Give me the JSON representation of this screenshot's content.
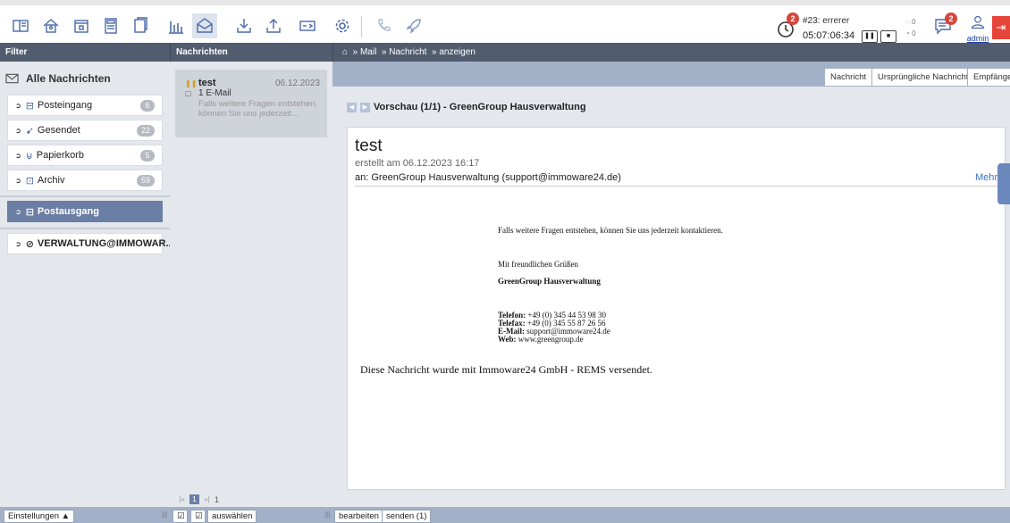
{
  "toolbar": {
    "icons": [
      "dashboard-icon",
      "home-icon",
      "calendar-icon",
      "calculator-icon",
      "documents-icon",
      "chart-icon",
      "mail-icon",
      "download-icon",
      "upload-icon",
      "card-icon",
      "settings-icon",
      "phone-icon",
      "rocket-icon"
    ],
    "active_icon": "mail-icon",
    "ticket_text": "#23: errerer",
    "ticket_time": "05:07:06:34",
    "ticket_badge": "2",
    "notes_badge": "2",
    "counter_a": "0",
    "counter_b": "0",
    "user_label": "admin"
  },
  "headers": {
    "filter": "Filter",
    "messages": "Nachrichten",
    "breadcrumb": [
      "Mail",
      "Nachricht",
      "anzeigen"
    ]
  },
  "filter": {
    "all_label": "Alle Nachrichten",
    "folders": [
      {
        "label": "Posteingang",
        "count": "6",
        "icon": "inbox-icon"
      },
      {
        "label": "Gesendet",
        "count": "22",
        "icon": "sent-icon"
      },
      {
        "label": "Papierkorb",
        "count": "5",
        "icon": "trash-icon"
      },
      {
        "label": "Archiv",
        "count": "59",
        "icon": "archive-icon"
      }
    ],
    "outbox_label": "Postausgang",
    "account_label": "VERWALTUNG@IMMOWAR..."
  },
  "messages": {
    "items": [
      {
        "subject": "test",
        "date": "06.12.2023",
        "mail_count": "1 E-Mail",
        "preview": "Falls weitere Fragen entstehen, können Sie uns jederzeit..."
      }
    ],
    "pager_page": "1",
    "pager_total": "1"
  },
  "content": {
    "tabs": [
      "Nachricht",
      "Ursprüngliche Nachricht",
      "Empfänger"
    ],
    "preview_title": "Vorschau (1/1) - GreenGroup Hausverwaltung",
    "mail": {
      "subject": "test",
      "created": "erstellt am 06.12.2023 16:17",
      "to": "an: GreenGroup Hausverwaltung (support@immoware24.de)",
      "more": "Mehr",
      "body_1": "Falls weitere Fragen entstehen, können Sie uns jederzeit kontaktieren.",
      "greeting": "Mit freundlichen Grüßen",
      "company": "GreenGroup Hausverwaltung",
      "phone_label": "Telefon:",
      "phone": "+49 (0) 345 44 53 98 30",
      "fax_label": "Telefax:",
      "fax": "+49 (0) 345 55 87 26 56",
      "email_label": "E-Mail:",
      "email": "support@immoware24.de",
      "web_label": "Web:",
      "web": "www.greengroup.de",
      "footer_note": "Diese Nachricht wurde mit Immoware24 GmbH - REMS versendet."
    }
  },
  "bottom": {
    "settings": "Einstellungen ▲",
    "select": "auswählen",
    "edit": "bearbeiten",
    "send": "senden (1)"
  }
}
